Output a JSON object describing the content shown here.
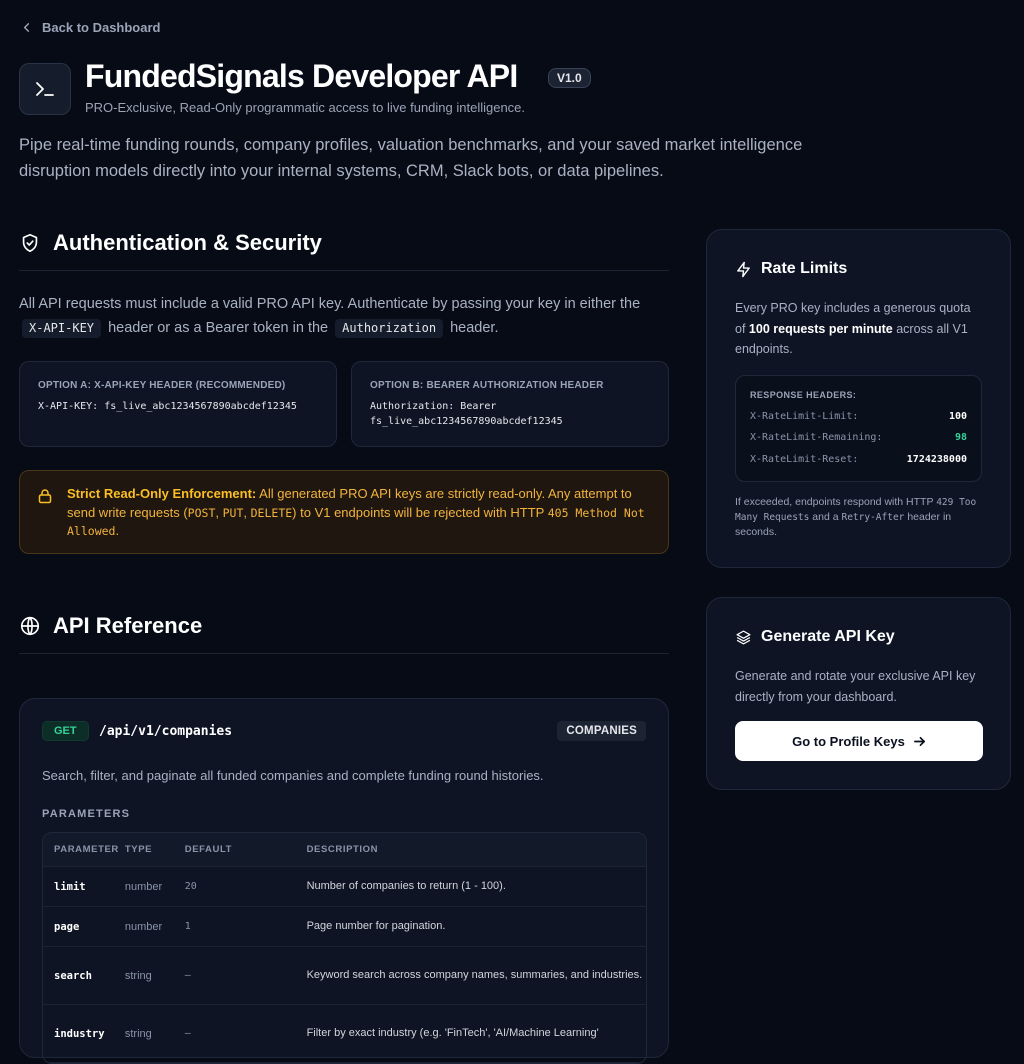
{
  "nav": {
    "back_label": "Back to Dashboard"
  },
  "header": {
    "title": "FundedSignals Developer API",
    "version": "V1.0",
    "subtitle": "PRO-Exclusive, Read-Only programmatic access to live funding intelligence.",
    "intro": "Pipe real-time funding rounds, company profiles, valuation benchmarks, and your saved market intelligence disruption models directly into your internal systems, CRM, Slack bots, or data pipelines."
  },
  "auth": {
    "heading": "Authentication & Security",
    "text_1": "All API requests must include a valid PRO API key. Authenticate by passing your key in either the",
    "chip_1": "X-API-KEY",
    "text_2": "header or as a Bearer token in the",
    "chip_2": "Authorization",
    "text_3": "header.",
    "option_a": {
      "title": "OPTION A: X-API-KEY HEADER (RECOMMENDED)",
      "code": "X-API-KEY: fs_live_abc1234567890abcdef12345"
    },
    "option_b": {
      "title": "OPTION B: BEARER AUTHORIZATION HEADER",
      "code_1": "Authorization: Bearer",
      "code_2": "fs_live_abc1234567890abcdef12345"
    },
    "warning": {
      "title": "Strict Read-Only Enforcement:",
      "text_1": "All generated PRO API keys are strictly read-only. Any attempt to send write requests (",
      "post": "POST",
      "sep_1": ", ",
      "put": "PUT",
      "sep_2": ", ",
      "delete": "DELETE",
      "text_2": ") to V1 endpoints will be rejected with HTTP",
      "status": "405 Method Not Allowed",
      "end": "."
    }
  },
  "reference": {
    "heading": "API Reference",
    "endpoint": {
      "method": "GET",
      "path": "/api/v1/companies",
      "tag": "COMPANIES",
      "description": "Search, filter, and paginate all funded companies and complete funding round histories.",
      "params_label": "PARAMETERS",
      "columns": [
        "PARAMETER",
        "TYPE",
        "DEFAULT",
        "DESCRIPTION"
      ],
      "rows": [
        {
          "name": "limit",
          "type": "number",
          "default": "20",
          "description": "Number of companies to return (1 - 100)."
        },
        {
          "name": "page",
          "type": "number",
          "default": "1",
          "description": "Page number for pagination."
        },
        {
          "name": "search",
          "type": "string",
          "default": "—",
          "description": "Keyword search across company names, summaries, and industries."
        },
        {
          "name": "industry",
          "type": "string",
          "default": "—",
          "description": "Filter by exact industry (e.g. 'FinTech', 'AI/Machine Learning'"
        }
      ]
    }
  },
  "rate_limits": {
    "heading": "Rate Limits",
    "text_1": "Every PRO key includes a generous quota of",
    "bold": "100 requests per minute",
    "text_2": "across all V1 endpoints.",
    "headers_title": "RESPONSE HEADERS:",
    "headers": [
      {
        "key": "X-RateLimit-Limit:",
        "value": "100"
      },
      {
        "key": "X-RateLimit-Remaining:",
        "value": "98"
      },
      {
        "key": "X-RateLimit-Reset:",
        "value": "1724238000"
      }
    ],
    "foot_1": "If exceeded, endpoints respond with HTTP",
    "foot_code": "429 Too Many Requests",
    "foot_2": "and a",
    "foot_code_2": "Retry-After",
    "foot_3": "header in seconds."
  },
  "generate": {
    "heading": "Generate API Key",
    "text": "Generate and rotate your exclusive API key directly from your dashboard.",
    "button": "Go to Profile Keys"
  },
  "colors": {
    "background": "#070b16",
    "card": "#0e1424",
    "accent_green": "#34d399",
    "warning": "#fbbf24"
  }
}
